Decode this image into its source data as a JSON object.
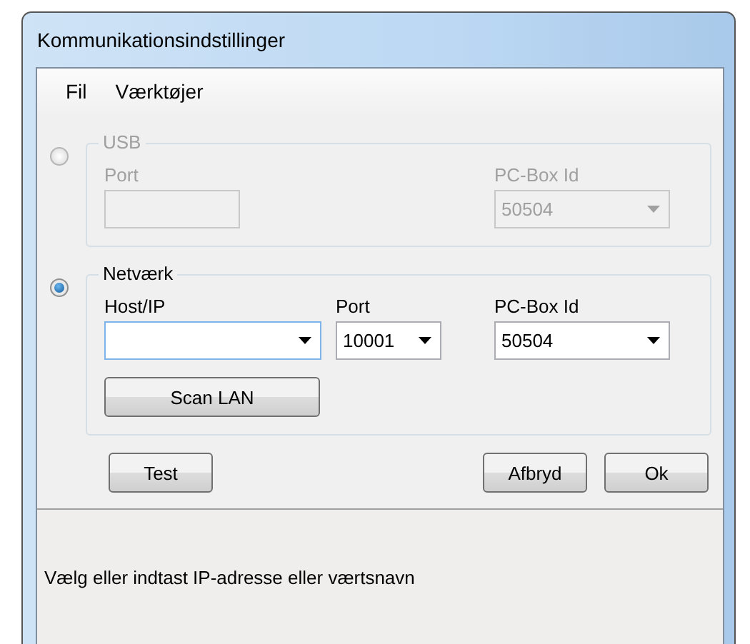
{
  "window": {
    "title": "Kommunikationsindstillinger"
  },
  "menu": [
    {
      "label": "Fil"
    },
    {
      "label": "Værktøjer"
    }
  ],
  "usb": {
    "selected": false,
    "disabled": true,
    "title": "USB",
    "port_label": "Port",
    "pcbox_label": "PC-Box Id",
    "pcbox_value": "50504"
  },
  "network": {
    "selected": true,
    "disabled": false,
    "title": "Netværk",
    "host_label": "Host/IP",
    "port_label": "Port",
    "port_value": "10001",
    "pcbox_label": "PC-Box Id",
    "pcbox_value": "50504",
    "scan_button": "Scan LAN"
  },
  "buttons": [
    {
      "label": "Test",
      "kind": "left"
    },
    {
      "label": "Afbryd",
      "kind": "right"
    },
    {
      "label": "Ok",
      "kind": "right"
    }
  ],
  "status_bar": {
    "text": "Vælg eller indtast IP-adresse eller værtsnavn"
  }
}
